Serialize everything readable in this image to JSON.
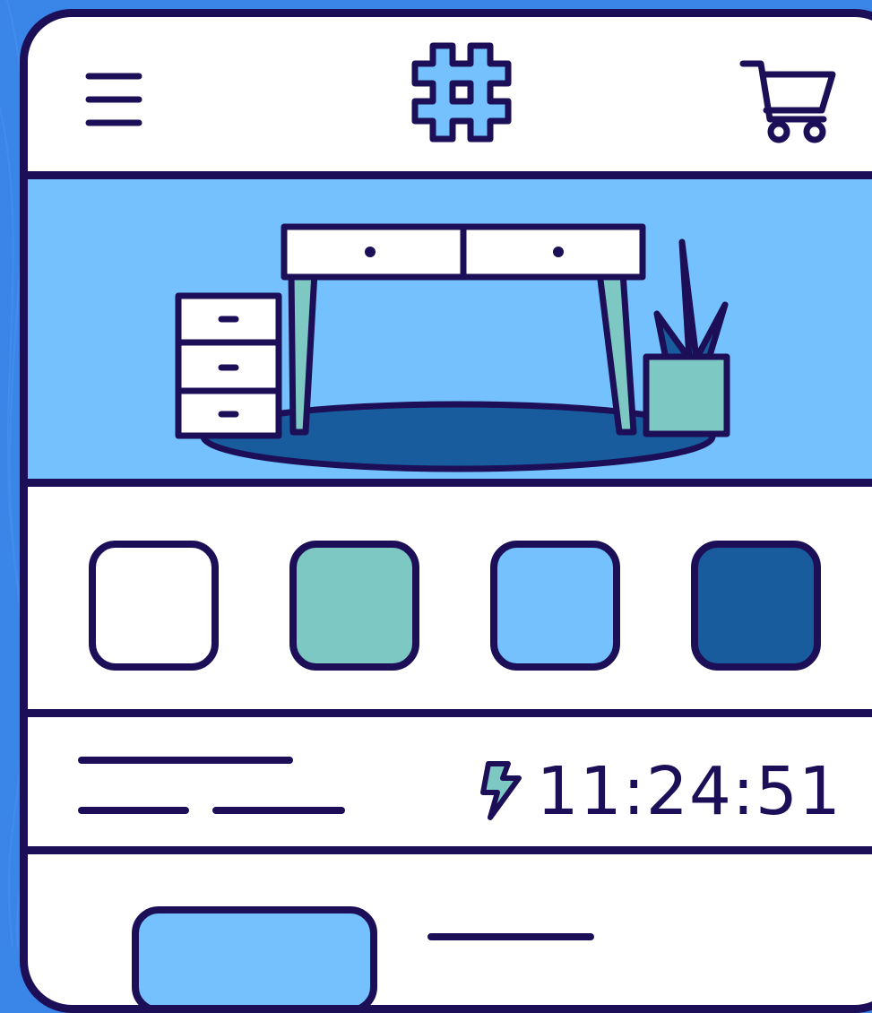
{
  "colors": {
    "outline": "#1c0f57",
    "background": "#3a86e8",
    "hero_bg": "#74c1fd",
    "rug": "#185c9d",
    "teal": "#7ec8c4"
  },
  "header": {
    "menu_icon": "hamburger-menu-icon",
    "logo_icon": "hashtag-logo-icon",
    "cart_icon": "shopping-cart-icon"
  },
  "hero": {
    "illustration": "desk-illustration"
  },
  "swatches": [
    {
      "color": "#ffffff"
    },
    {
      "color": "#7ec8c4"
    },
    {
      "color": "#74c1fd"
    },
    {
      "color": "#185c9d"
    }
  ],
  "info": {
    "timer_icon": "lightning-bolt-icon",
    "time": "11:24:51"
  }
}
